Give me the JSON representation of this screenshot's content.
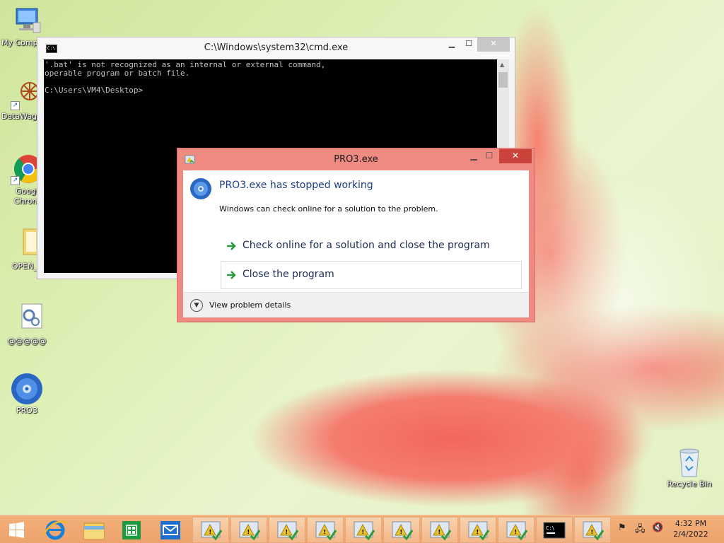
{
  "desktop": {
    "icons": [
      {
        "label": "My Comp",
        "icon": "computer-icon"
      },
      {
        "label": "DataWag",
        "icon": "datawag-icon"
      },
      {
        "label": "Googl",
        "label2": "Chrom",
        "icon": "chrome-icon"
      },
      {
        "label": "OPEN_F",
        "icon": "folder-icon"
      },
      {
        "label": "@@@@@",
        "icon": "settings-doc-icon"
      },
      {
        "label": "PRO3",
        "icon": "disc-icon"
      },
      {
        "label": "Recycle Bin",
        "icon": "recycle-bin-icon"
      }
    ]
  },
  "cmd_window": {
    "title": "C:\\Windows\\system32\\cmd.exe",
    "lines": [
      "'.bat' is not recognized as an internal or external command,",
      "operable program or batch file.",
      "",
      "C:\\Users\\VM4\\Desktop>"
    ]
  },
  "error_dialog": {
    "title": "PRO3.exe",
    "heading": "PRO3.exe has stopped working",
    "subtext": "Windows can check online for a solution to the problem.",
    "option_check_online": "Check online for a solution and close the program",
    "option_close": "Close the program",
    "details_link": "View problem details"
  },
  "taskbar": {
    "pinned": [
      "start-icon",
      "internet-explorer-icon",
      "file-explorer-icon",
      "store-icon",
      "mail-icon"
    ],
    "running_count": 11,
    "clock_time": "4:32 PM",
    "clock_date": "2/4/2022"
  },
  "colors": {
    "dialog_border": "#ef8a82",
    "close_button": "#c9433a",
    "taskbar": "#eea36c",
    "heading_text": "#1e3f8a"
  }
}
